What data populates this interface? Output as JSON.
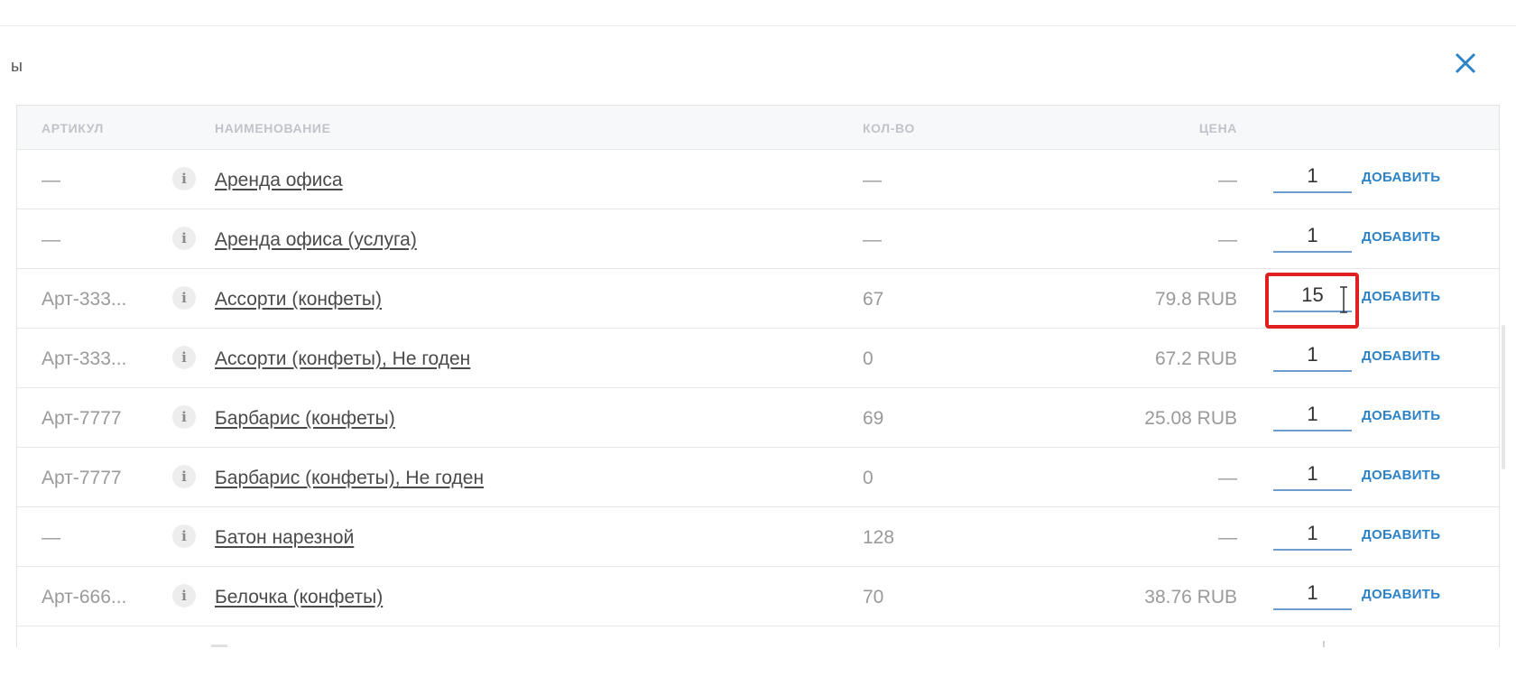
{
  "modal": {
    "title": "ы"
  },
  "table": {
    "headers": {
      "sku": "АРТИКУЛ",
      "name": "НАИМЕНОВАНИЕ",
      "qty": "КОЛ-ВО",
      "price": "ЦЕНА"
    },
    "rows": [
      {
        "sku": "—",
        "name": "Аренда офиса",
        "qty": "—",
        "price": "—",
        "amount": "1",
        "add": "ДОБАВИТЬ"
      },
      {
        "sku": "—",
        "name": "Аренда офиса (услуга)",
        "qty": "—",
        "price": "—",
        "amount": "1",
        "add": "ДОБАВИТЬ"
      },
      {
        "sku": "Арт-333...",
        "name": "Ассорти (конфеты)",
        "qty": "67",
        "price": "79.8 RUB",
        "amount": "15",
        "add": "ДОБАВИТЬ"
      },
      {
        "sku": "Арт-333...",
        "name": "Ассорти (конфеты), Не годен",
        "qty": "0",
        "price": "67.2 RUB",
        "amount": "1",
        "add": "ДОБАВИТЬ"
      },
      {
        "sku": "Арт-7777",
        "name": "Барбарис (конфеты)",
        "qty": "69",
        "price": "25.08 RUB",
        "amount": "1",
        "add": "ДОБАВИТЬ"
      },
      {
        "sku": "Арт-7777",
        "name": "Барбарис (конфеты), Не годен",
        "qty": "0",
        "price": "—",
        "amount": "1",
        "add": "ДОБАВИТЬ"
      },
      {
        "sku": "—",
        "name": "Батон нарезной",
        "qty": "128",
        "price": "—",
        "amount": "1",
        "add": "ДОБАВИТЬ"
      },
      {
        "sku": "Арт-666...",
        "name": "Белочка (конфеты)",
        "qty": "70",
        "price": "38.76 RUB",
        "amount": "1",
        "add": "ДОБАВИТЬ"
      }
    ]
  },
  "icons": {
    "close": "close-icon",
    "info": "info-icon",
    "info_glyph": "i"
  },
  "colors": {
    "accent": "#2d83c6",
    "highlight": "#e02020"
  }
}
